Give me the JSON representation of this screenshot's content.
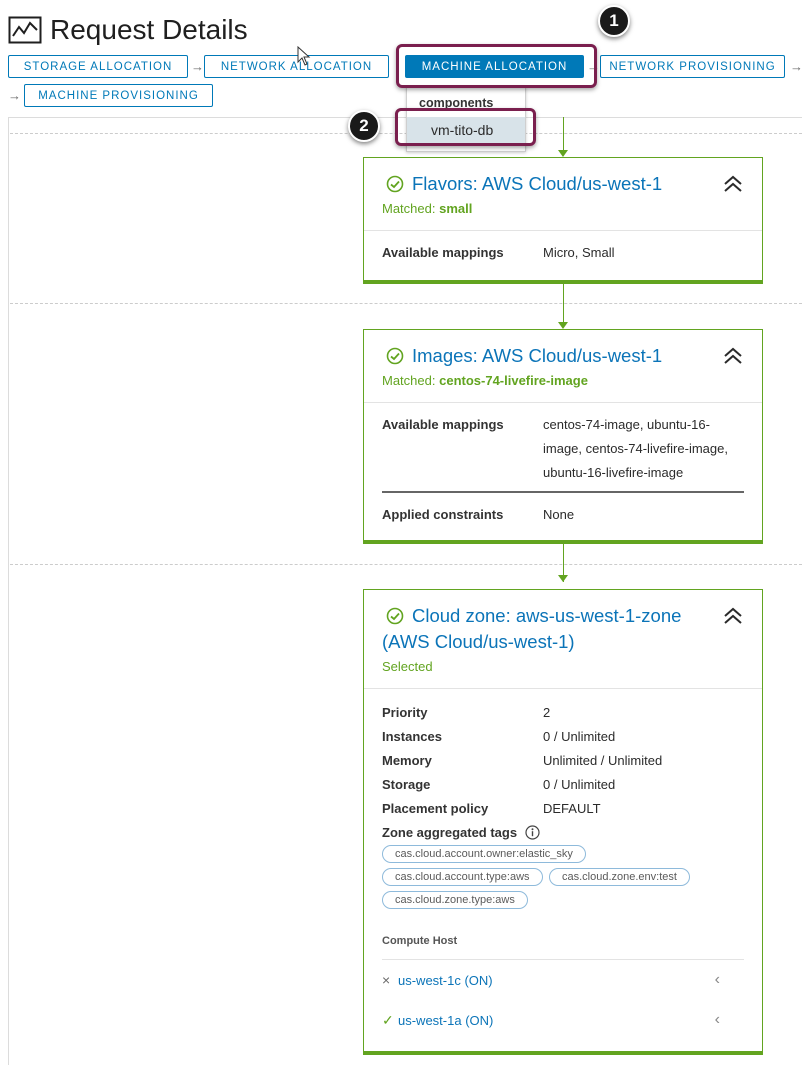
{
  "page": {
    "title": "Request Details",
    "icon": "activity-chart-icon"
  },
  "steps": [
    {
      "label": "STORAGE ALLOCATION",
      "active": false
    },
    {
      "label": "NETWORK ALLOCATION",
      "active": false
    },
    {
      "label": "MACHINE ALLOCATION",
      "active": true
    },
    {
      "label": "NETWORK PROVISIONING",
      "active": false
    },
    {
      "label": "MACHINE PROVISIONING",
      "active": false
    }
  ],
  "annotations": {
    "badge1": "1",
    "badge2": "2"
  },
  "dropdown": {
    "header": "components",
    "item": "vm-tito-db"
  },
  "cards": {
    "flavors": {
      "title": "Flavors: AWS Cloud/us-west-1",
      "matched_label": "Matched:",
      "matched_value": "small",
      "rows": [
        {
          "key": "Available mappings",
          "value": "Micro, Small"
        }
      ]
    },
    "images": {
      "title": "Images: AWS Cloud/us-west-1",
      "matched_label": "Matched:",
      "matched_value": "centos-74-livefire-image",
      "rows": [
        {
          "key": "Available mappings",
          "value": "centos-74-image, ubuntu-16-image, centos-74-livefire-image, ubuntu-16-livefire-image"
        },
        {
          "key": "Applied constraints",
          "value": "None"
        }
      ]
    },
    "zone": {
      "title": "Cloud zone: aws-us-west-1-zone (AWS Cloud/us-west-1)",
      "status": "Selected",
      "rows": [
        {
          "key": "Priority",
          "value": "2"
        },
        {
          "key": "Instances",
          "value": "0 / Unlimited"
        },
        {
          "key": "Memory",
          "value": "Unlimited / Unlimited"
        },
        {
          "key": "Storage",
          "value": "0 / Unlimited"
        },
        {
          "key": "Placement policy",
          "value": "DEFAULT"
        }
      ],
      "tags_label": "Zone aggregated tags",
      "tags": [
        "cas.cloud.account.owner:elastic_sky",
        "cas.cloud.account.type:aws",
        "cas.cloud.zone.env:test",
        "cas.cloud.zone.type:aws"
      ],
      "compute_host_label": "Compute Host",
      "hosts": [
        {
          "name": "us-west-1c (ON)",
          "state": "×",
          "state_color": "#6a6a6a"
        },
        {
          "name": "us-west-1a (ON)",
          "state": "✓",
          "state_color": "#62a420"
        }
      ],
      "expand_glyph": "‹"
    }
  },
  "colors": {
    "accent": "#0079b8",
    "success": "#62a420",
    "highlight": "#7a1f4e"
  }
}
